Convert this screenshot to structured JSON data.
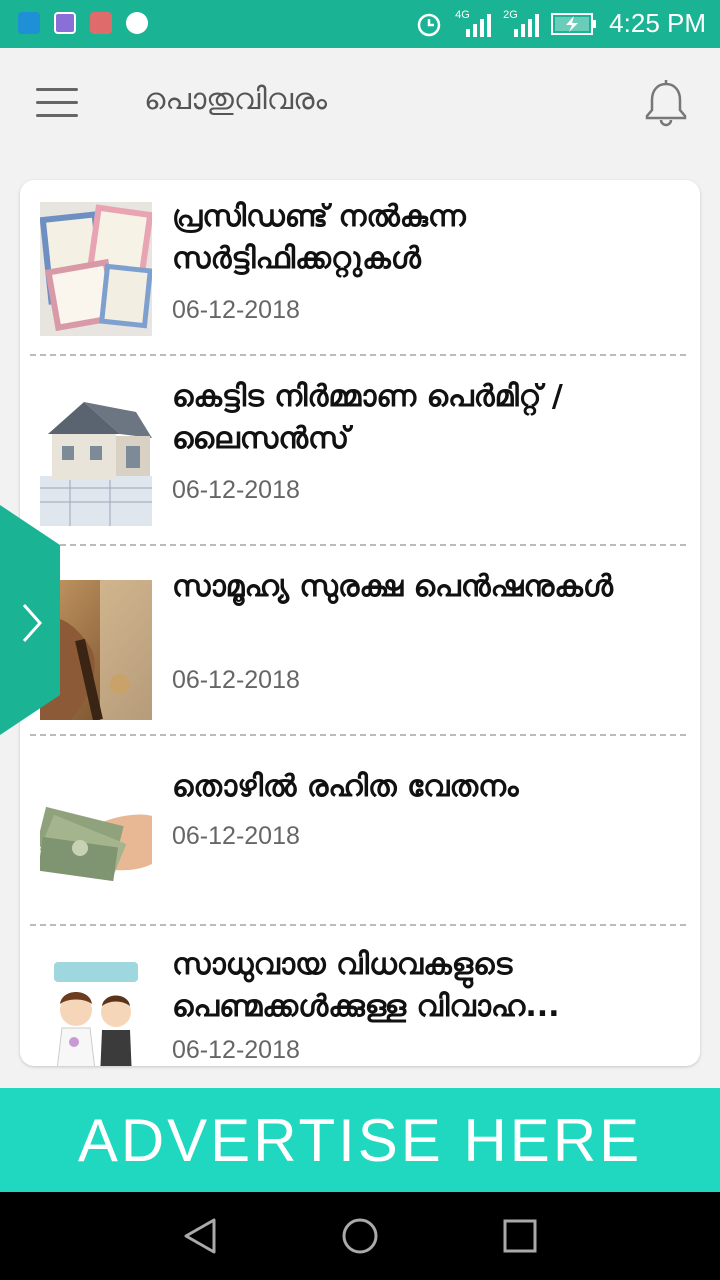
{
  "status_bar": {
    "time": "4:25 PM",
    "network_1": "4G",
    "network_2": "2G",
    "icons": [
      "usb-icon",
      "gallery-icon",
      "multi-window-icon",
      "app-icon",
      "alarm-icon",
      "signal-icon",
      "battery-charging-icon"
    ]
  },
  "header": {
    "title": "പൊതുവിവരം",
    "menu_icon": "hamburger-menu-icon",
    "notification_icon": "bell-icon"
  },
  "list": {
    "items": [
      {
        "title": "പ്രസിഡണ്ട് നൽകുന്ന സർട്ടിഫിക്കറ്റുകൾ",
        "date": "06-12-2018",
        "thumbnail": "certificates-image"
      },
      {
        "title": "കെട്ടിട നിർമ്മാണ  പെർമിറ്റ് / ലൈസൻസ്",
        "date": "06-12-2018",
        "thumbnail": "house-blueprint-image"
      },
      {
        "title": "സാമൂഹ്യ സുരക്ഷ പെൻഷനുകൾ",
        "date": "06-12-2018",
        "thumbnail": "elderly-hands-image"
      },
      {
        "title": "തൊഴിൽ രഹിത വേതനം",
        "date": "06-12-2018",
        "thumbnail": "money-hand-image"
      },
      {
        "title": "സാധുവായ വിധവകളുടെ പെണ്മക്കൾക്കുള്ള  വിവാഹ...",
        "date": "06-12-2018",
        "thumbnail": "wedding-couple-image"
      }
    ]
  },
  "side_tab": {
    "icon": "chevron-right-icon"
  },
  "advert": {
    "label": "ADVERTISE HERE"
  },
  "nav": {
    "back_icon": "back-triangle-icon",
    "home_icon": "home-circle-icon",
    "recents_icon": "recents-square-icon"
  },
  "colors": {
    "status_bar": "#1ab394",
    "advert_bg": "#20d8bf",
    "side_tab": "#1ab394"
  }
}
